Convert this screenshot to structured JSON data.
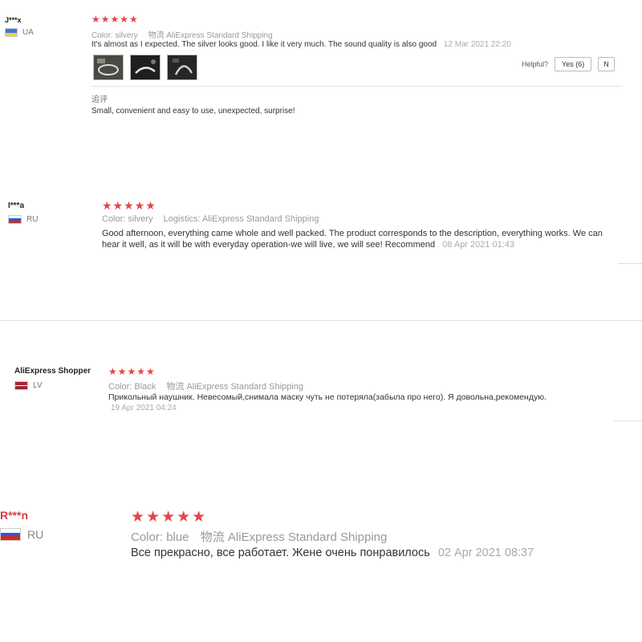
{
  "reviews": [
    {
      "user": "J***x",
      "country": "UA",
      "stars": "★★★★★",
      "color_label": "Color:",
      "color_value": "silvery",
      "shipping_label": "物流",
      "shipping_value": "AliExpress Standard Shipping",
      "text": "It's almost as I expected. The silver looks good. I like it very much. The sound quality is also good",
      "date": "12 Mar 2021 22:20",
      "helpful_label": "Helpful?",
      "yes_label": "Yes (6)",
      "no_label": "N",
      "followup_label": "追评",
      "followup_text": "Small, convenient and easy to use, unexpected, surprise!"
    },
    {
      "user": "I***a",
      "country": "RU",
      "stars": "★★★★★",
      "color_label": "Color:",
      "color_value": "silvery",
      "shipping_label": "Logistics:",
      "shipping_value": "AliExpress Standard Shipping",
      "text": "Good afternoon, everything came whole and well packed. The product corresponds to the description, everything works. We can hear it well, as it will be with everyday operation-we will live, we will see! Recommend",
      "date": "08 Apr 2021 01:43"
    },
    {
      "user": "AliExpress Shopper",
      "country": "LV",
      "stars": "★★★★★",
      "color_label": "Color:",
      "color_value": "Black",
      "shipping_label": "物流",
      "shipping_value": "AliExpress Standard Shipping",
      "text": "Прикольный наушник. Невесомый,снимала маску чуть не потеряла(забыла про него). Я довольна,рекомендую.",
      "date": "19 Apr 2021 04:24"
    },
    {
      "user": "R***n",
      "country": "RU",
      "stars": "★★★★★",
      "color_label": "Color:",
      "color_value": "blue",
      "shipping_label": "物流",
      "shipping_value": "AliExpress Standard Shipping",
      "text": "Все прекрасно, все работает. Жене очень понравилось",
      "date": "02 Apr 2021 08:37"
    }
  ],
  "colors": {
    "star": "#e64545",
    "text": "#333333",
    "muted": "#999999"
  }
}
